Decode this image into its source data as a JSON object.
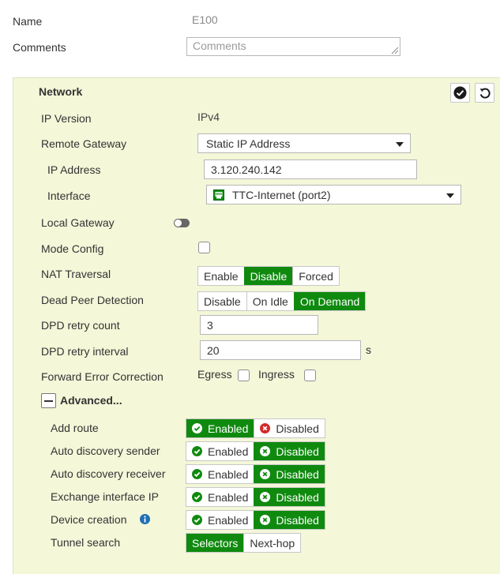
{
  "form": {
    "name_label": "Name",
    "name_value": "E100",
    "comments_label": "Comments",
    "comments_placeholder": "Comments"
  },
  "network": {
    "title": "Network",
    "ip_version_label": "IP Version",
    "ip_version_value": "IPv4",
    "remote_gateway_label": "Remote Gateway",
    "remote_gateway_value": "Static IP Address",
    "ip_address_label": "IP Address",
    "ip_address_value": "3.120.240.142",
    "interface_label": "Interface",
    "interface_value": "TTC-Internet (port2)",
    "local_gateway_label": "Local Gateway",
    "local_gateway_enabled": false,
    "mode_config_label": "Mode Config",
    "mode_config_checked": false,
    "nat_traversal_label": "NAT Traversal",
    "nat_traversal_options": [
      "Enable",
      "Disable",
      "Forced"
    ],
    "nat_traversal_selected": "Disable",
    "dpd_label": "Dead Peer Detection",
    "dpd_options": [
      "Disable",
      "On Idle",
      "On Demand"
    ],
    "dpd_selected": "On Demand",
    "dpd_retry_count_label": "DPD retry count",
    "dpd_retry_count_value": "3",
    "dpd_retry_interval_label": "DPD retry interval",
    "dpd_retry_interval_value": "20",
    "dpd_retry_interval_unit": "s",
    "fec_label": "Forward Error Correction",
    "fec_egress_label": "Egress",
    "fec_egress_checked": false,
    "fec_ingress_label": "Ingress",
    "fec_ingress_checked": false
  },
  "advanced": {
    "title": "Advanced...",
    "enabled_label": "Enabled",
    "disabled_label": "Disabled",
    "rows": [
      {
        "label": "Add route",
        "selected": "Enabled"
      },
      {
        "label": "Auto discovery sender",
        "selected": "Disabled"
      },
      {
        "label": "Auto discovery receiver",
        "selected": "Disabled"
      },
      {
        "label": "Exchange interface IP",
        "selected": "Disabled"
      },
      {
        "label": "Device creation",
        "selected": "Disabled"
      }
    ],
    "tunnel_search_label": "Tunnel search",
    "tunnel_search_options": [
      "Selectors",
      "Next-hop"
    ],
    "tunnel_search_selected": "Selectors"
  },
  "colors": {
    "accent_green": "#0f8a0f",
    "panel_bg": "#f4f7d8",
    "error_red": "#d62828",
    "info_blue": "#1f6fb5"
  },
  "icons": {
    "apply": "check-circle-icon",
    "revert": "undo-icon",
    "interface": "network-port-icon",
    "collapse": "minus-square-icon",
    "info": "info-circle-icon"
  }
}
